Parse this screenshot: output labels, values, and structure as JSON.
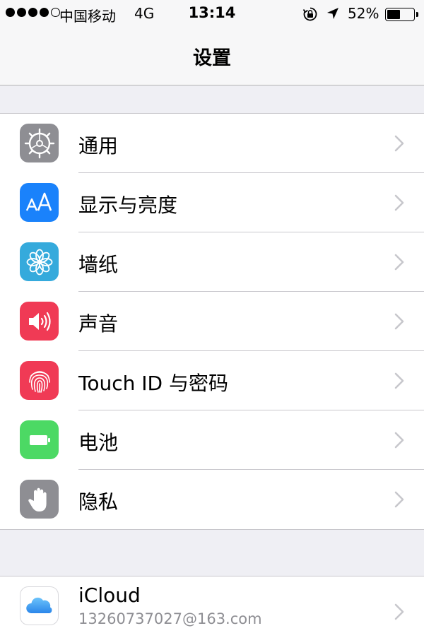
{
  "status_bar": {
    "carrier": "中国移动",
    "network": "4G",
    "time": "13:14",
    "battery_percent_text": "52%",
    "battery_level": 0.52,
    "signal_strength": 4,
    "signal_max": 5
  },
  "nav": {
    "title": "设置"
  },
  "settings_group1": [
    {
      "label": "通用",
      "icon": "gear-icon",
      "color": "#8e8e93"
    },
    {
      "label": "显示与亮度",
      "icon": "text-size-icon",
      "color": "#1a82fb"
    },
    {
      "label": "墙纸",
      "icon": "flower-icon",
      "color": "#35aadc"
    },
    {
      "label": "声音",
      "icon": "speaker-icon",
      "color": "#f03a55"
    },
    {
      "label": "Touch ID 与密码",
      "icon": "fingerprint-icon",
      "color": "#f03a55"
    },
    {
      "label": "电池",
      "icon": "battery-icon",
      "color": "#4cd964"
    },
    {
      "label": "隐私",
      "icon": "hand-icon",
      "color": "#8e8e93"
    }
  ],
  "icloud": {
    "label": "iCloud",
    "account": "13260737027@163.com",
    "icon": "icloud-icon",
    "color": "#3a9ff5"
  }
}
